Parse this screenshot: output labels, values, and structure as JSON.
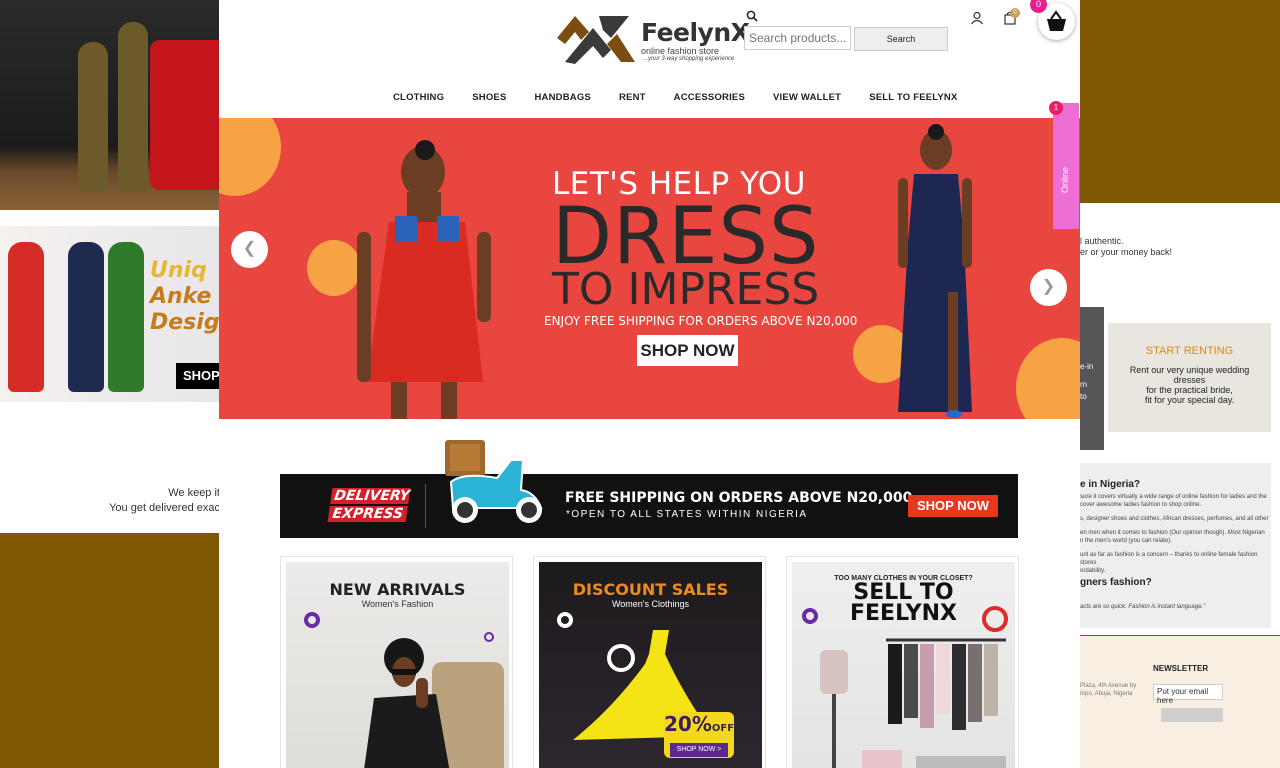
{
  "header": {
    "brand": "FeelynX",
    "tagline": "online fashion store",
    "subtagline": "...your 3-way shopping experience",
    "search": {
      "placeholder": "Search products...",
      "button": "Search"
    },
    "cart_count": "0"
  },
  "nav": [
    "CLOTHING",
    "SHOES",
    "HANDBAGS",
    "RENT",
    "ACCESSORIES",
    "VIEW WALLET",
    "SELL TO FEELYNX"
  ],
  "hero": {
    "line1": "LET'S HELP YOU",
    "line2": "DRESS",
    "line3_a": "TO",
    "line3_b": "IMPRESS",
    "line4": "ENJOY FREE SHIPPING FOR ORDERS ABOVE N20,000",
    "cta": "SHOP NOW",
    "prev_icon": "chevron-left-icon",
    "next_icon": "chevron-right-icon"
  },
  "online_widget": {
    "label": "Online",
    "badge": "1"
  },
  "delivery_banner": {
    "badge_line1": "DELIVERY",
    "badge_line2": "EXPRESS",
    "headline": "FREE SHIPPING ON ORDERS ABOVE N20,000",
    "subline": "*OPEN TO ALL STATES WITHIN NIGERIA",
    "cta": "SHOP NOW"
  },
  "cards": [
    {
      "title": "NEW ARRIVALS",
      "subtitle": "Women's Fashion"
    },
    {
      "title": "DISCOUNT SALES",
      "subtitle": "Women's Clothings",
      "badge_pct": "20%",
      "badge_off": "OFF",
      "badge_cta": "SHOP NOW >"
    },
    {
      "kicker": "TOO MANY CLOTHES IN YOUR CLOSET?",
      "title_1": "SELL TO",
      "title_2": "FEELYNX"
    }
  ],
  "floating_basket": {
    "badge": "0"
  },
  "background": {
    "left_banner_word1": "Uniq",
    "left_banner_word2": "Anke",
    "left_banner_word3": "Desig",
    "left_shop": "SHOP",
    "keep_line1": "We keep it",
    "keep_line2": "You get delivered exac",
    "auth_line1": "l authentic.",
    "auth_line2": "er or your money back!",
    "dark_line1": "e-in",
    "dark_line2": "rn",
    "dark_line3": "to",
    "rent_title": "START RENTING",
    "rent_desc_1": "Rent our very unique wedding",
    "rent_desc_2": "dresses",
    "rent_desc_3": "for the practical bride,",
    "rent_desc_4": "fit for your special day.",
    "faq_title": "e in Nigeria?",
    "faq_p1": "sure it covers virtually a wide range of online fashion for ladies and the",
    "faq_p2": "cover awesome ladies fashion to shop online.",
    "faq_p3": "s, designer shoes and clothes, African dresses, perfumes, and all other",
    "faq_p4": "en men when it comes to fashion (Our opinion though). Most Nigerian",
    "faq_p5": "n the men's world (you can relate).",
    "faq_p6": "unt as far as fashion is a concern – thanks to online female fashion stores",
    "faq_p7": "ordability.",
    "faq_q2": "gners fashion?",
    "faq_quote": "acts are so quick. Fashion is instant language.\"",
    "newsletter_title": "NEWSLETTER",
    "newsletter_placeholder": "Put your email here",
    "address_1": "Plaza, 4th Avenue by",
    "address_2": "Inpo, Abuja, Nigeria"
  }
}
